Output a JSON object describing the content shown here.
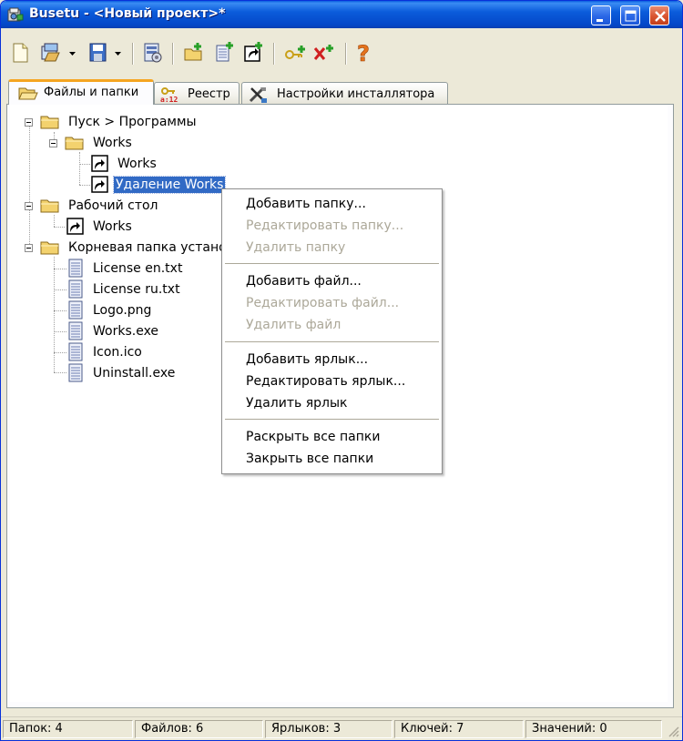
{
  "window": {
    "title": "Busetu - <Новый проект>*",
    "controls": [
      "minimize",
      "maximize",
      "close"
    ]
  },
  "toolbar": {
    "buttons": [
      {
        "name": "new-project",
        "icon": "new-document-icon"
      },
      {
        "name": "open-project",
        "icon": "open-folder-icon",
        "has_dropdown": true
      },
      {
        "name": "save-project",
        "icon": "floppy-disk-icon",
        "has_dropdown": true
      },
      {
        "name": "build",
        "icon": "build-installer-icon"
      },
      {
        "name": "add-folder",
        "icon": "add-folder-icon"
      },
      {
        "name": "add-file",
        "icon": "add-file-icon"
      },
      {
        "name": "add-shortcut",
        "icon": "shortcut-icon"
      },
      {
        "name": "add-key",
        "icon": "add-key-icon"
      },
      {
        "name": "add-value",
        "icon": "add-value-icon"
      },
      {
        "name": "help",
        "icon": "help-icon"
      }
    ]
  },
  "tabs": [
    {
      "label": "Файлы и папки",
      "active": true,
      "icon": "folder-open-icon"
    },
    {
      "label": "Реестр",
      "active": false,
      "icon": "registry-icon"
    },
    {
      "label": "Настройки инсталлятора",
      "active": false,
      "icon": "tools-icon"
    }
  ],
  "tree": {
    "start_menu": {
      "label": "Пуск > Программы"
    },
    "works_folder": {
      "label": "Works"
    },
    "works_shortcut": {
      "label": "Works"
    },
    "uninstall_shortcut": {
      "label": "Удаление Works"
    },
    "desktop": {
      "label": "Рабочий стол"
    },
    "desktop_works": {
      "label": "Works"
    },
    "root_folder": {
      "label": "Корневая папка устано"
    },
    "files": [
      "License en.txt",
      "License ru.txt",
      "Logo.png",
      "Works.exe",
      "Icon.ico",
      "Uninstall.exe"
    ]
  },
  "context_menu": {
    "groups": [
      [
        {
          "label": "Добавить папку...",
          "enabled": true
        },
        {
          "label": "Редактировать папку...",
          "enabled": false
        },
        {
          "label": "Удалить папку",
          "enabled": false
        }
      ],
      [
        {
          "label": "Добавить файл...",
          "enabled": true
        },
        {
          "label": "Редактировать файл...",
          "enabled": false
        },
        {
          "label": "Удалить файл",
          "enabled": false
        }
      ],
      [
        {
          "label": "Добавить ярлык...",
          "enabled": true
        },
        {
          "label": "Редактировать ярлык...",
          "enabled": true
        },
        {
          "label": "Удалить ярлык",
          "enabled": true
        }
      ],
      [
        {
          "label": "Раскрыть все папки",
          "enabled": true
        },
        {
          "label": "Закрыть все папки",
          "enabled": true
        }
      ]
    ]
  },
  "statusbar": {
    "folders": "Папок: 4",
    "files": "Файлов: 6",
    "shortcuts": "Ярлыков: 3",
    "keys": "Ключей: 7",
    "values": "Значений: 0"
  },
  "colors": {
    "titlebar": "#0b5cdb",
    "selection": "#316ac5",
    "disabled_text": "#aca899",
    "active_tab_accent": "#f5a521"
  }
}
